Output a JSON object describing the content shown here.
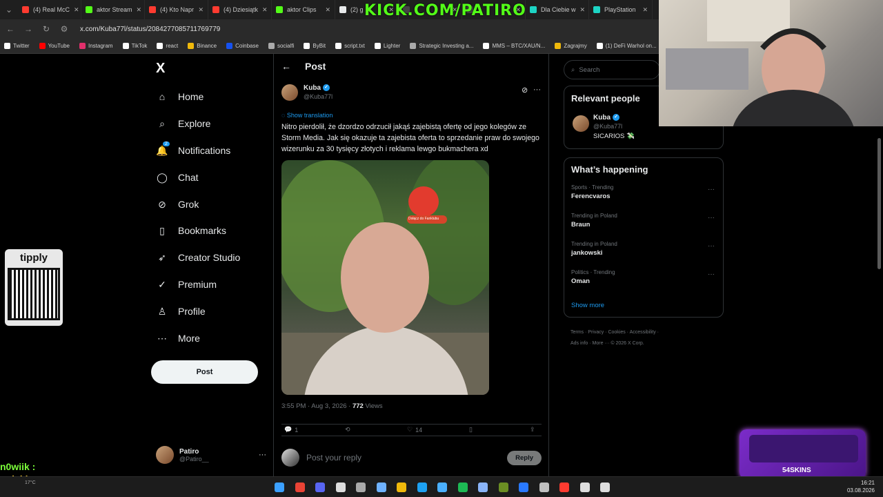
{
  "browser": {
    "tabs": [
      {
        "label": "(4) Real McC",
        "color": "#ff3b30"
      },
      {
        "label": "aktor Stream",
        "color": "#53fc18"
      },
      {
        "label": "(4) Kto Napr",
        "color": "#ff3b30"
      },
      {
        "label": "(4) Dziesiątk",
        "color": "#ff3b30"
      },
      {
        "label": "aktor Clips",
        "color": "#53fc18"
      },
      {
        "label": "(2) g",
        "color": "#e7e9ea"
      },
      {
        "label": "",
        "color": "#444"
      },
      {
        "label": "",
        "color": "#444"
      },
      {
        "label": "Dla Ciebie w",
        "color": "#1dd4c4"
      },
      {
        "label": "PlayStation",
        "color": "#1dd4c4"
      }
    ],
    "url": "x.com/Kuba77l/status/2084277085711769779",
    "bookmarks": [
      {
        "label": "Twitter",
        "color": "#fff"
      },
      {
        "label": "YouTube",
        "color": "#ff0000"
      },
      {
        "label": "Instagram",
        "color": "#e1306c"
      },
      {
        "label": "TikTok",
        "color": "#fff"
      },
      {
        "label": "react",
        "color": "#fff"
      },
      {
        "label": "Binance",
        "color": "#f0b90b"
      },
      {
        "label": "Coinbase",
        "color": "#1652f0"
      },
      {
        "label": "socialfi",
        "color": "#aaa"
      },
      {
        "label": "ByBit",
        "color": "#fff"
      },
      {
        "label": "script.txt",
        "color": "#fff"
      },
      {
        "label": "Lighter",
        "color": "#fff"
      },
      {
        "label": "Strategic Investing a...",
        "color": "#aaa"
      },
      {
        "label": "MMS – BTC/XAU/N...",
        "color": "#fff"
      },
      {
        "label": "Zagrajmy",
        "color": "#f0b90b"
      },
      {
        "label": "(1) DeFi Warhol on...",
        "color": "#fff"
      }
    ]
  },
  "overlay": {
    "kick_text": "KICK.COM/PATIRO",
    "chat_user": "n0wiik :",
    "chat_user2": "polski :",
    "tipply_label": "tipply",
    "skins_label": "54SKINS"
  },
  "nav": {
    "logo": "X",
    "items": [
      {
        "label": "Home",
        "icon": "home-icon",
        "glyph": "⌂"
      },
      {
        "label": "Explore",
        "icon": "search-icon",
        "glyph": "⌕"
      },
      {
        "label": "Notifications",
        "icon": "bell-icon",
        "glyph": "🔔"
      },
      {
        "label": "Chat",
        "icon": "chat-icon",
        "glyph": "◯"
      },
      {
        "label": "Grok",
        "icon": "grok-icon",
        "glyph": "⊘"
      },
      {
        "label": "Bookmarks",
        "icon": "bookmark-icon",
        "glyph": "▯"
      },
      {
        "label": "Creator Studio",
        "icon": "rocket-icon",
        "glyph": "➶"
      },
      {
        "label": "Premium",
        "icon": "premium-icon",
        "glyph": "✓"
      },
      {
        "label": "Profile",
        "icon": "person-icon",
        "glyph": "♙"
      },
      {
        "label": "More",
        "icon": "more-icon",
        "glyph": "⋯"
      }
    ],
    "notification_count": "2",
    "post_button": "Post",
    "account_name": "Patiro",
    "account_handle": "@Patiro__"
  },
  "post": {
    "header": "Post",
    "author_name": "Kuba",
    "author_handle": "@Kuba77l",
    "show_translation": "Show translation",
    "text": "Nitro pierdolił, że dzordzo odrzucił jakąś zajebistą ofertę od jego kolegów ze Storm Media. Jak się okazuje ta zajebista oferta to sprzedanie praw do swojego wizerunku za 30 tysięcy złotych i reklama lewgo bukmachera xd",
    "media_caption": "Dołącz do Fanklubu",
    "time": "3:55 PM · Aug 3, 2026 ·",
    "views_count": "772",
    "views_label": "Views",
    "replies": "1",
    "likes": "14",
    "reply_placeholder": "Post your reply",
    "reply_button": "Reply"
  },
  "sidebar": {
    "search_placeholder": "Search",
    "relevant_title": "Relevant people",
    "person_name": "Kuba",
    "person_handle": "@Kuba77l",
    "person_bio": "SICARIOS 💸",
    "happening_title": "What’s happening",
    "trends": [
      {
        "category": "Sports · Trending",
        "title": "Ferencvaros"
      },
      {
        "category": "Trending in Poland",
        "title": "Braun"
      },
      {
        "category": "Trending in Poland",
        "title": "jankowski"
      },
      {
        "category": "Politics · Trending",
        "title": "Oman"
      }
    ],
    "show_more": "Show more",
    "footer_line1": "Terms · Privacy · Cookies · Accessibility ·",
    "footer_line2": "Ads info · More ··· © 2026 X Corp."
  },
  "taskbar": {
    "time": "16:21",
    "date": "03.08.2026",
    "weather": "17°C"
  }
}
